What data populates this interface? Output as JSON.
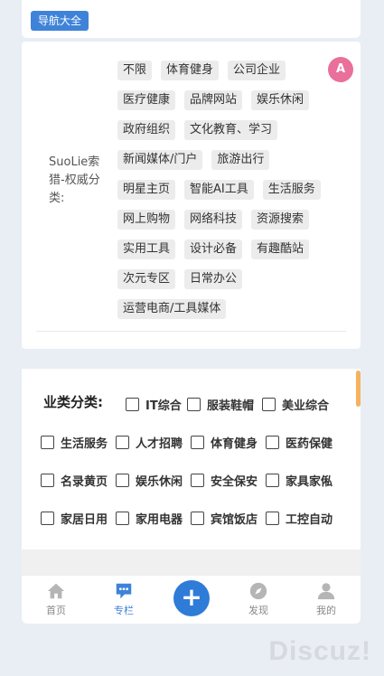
{
  "top": {
    "nav_badge": "导航大全"
  },
  "translate_icon": "A",
  "category": {
    "label": "SuoLie索猎-权威分类:",
    "tags": [
      "不限",
      "体育健身",
      "公司企业",
      "医疗健康",
      "品牌网站",
      "娱乐休闲",
      "政府组织",
      "文化教育、学习",
      "新闻媒体/门户",
      "旅游出行",
      "明星主页",
      "智能AI工具",
      "生活服务",
      "网上购物",
      "网络科技",
      "资源搜索",
      "实用工具",
      "设计必备",
      "有趣酷站",
      "次元专区",
      "日常办公",
      "运营电商/工具媒体"
    ]
  },
  "business": {
    "title": "业类分类:",
    "options": [
      "IT综合",
      "服装鞋帽",
      "美业综合",
      "生活服务",
      "人才招聘",
      "体育健身",
      "医药保健",
      "名录黄页",
      "娱乐休闲",
      "安全保安",
      "家具家俬",
      "家居日用",
      "家用电器",
      "宾馆饭店",
      "工控自动"
    ]
  },
  "bottom_nav": {
    "items": [
      {
        "label": "首页",
        "icon": "home-icon"
      },
      {
        "label": "专栏",
        "icon": "chat-icon",
        "active": true
      },
      {
        "label": "+",
        "icon": "plus-icon"
      },
      {
        "label": "发现",
        "icon": "compass-icon"
      },
      {
        "label": "我的",
        "icon": "user-icon"
      }
    ]
  },
  "watermark": "Discuz!",
  "colors": {
    "accent": "#3f83d9",
    "plus": "#2f7bd8",
    "translate": "#e9709a",
    "scrollbar": "#f5b35e"
  }
}
